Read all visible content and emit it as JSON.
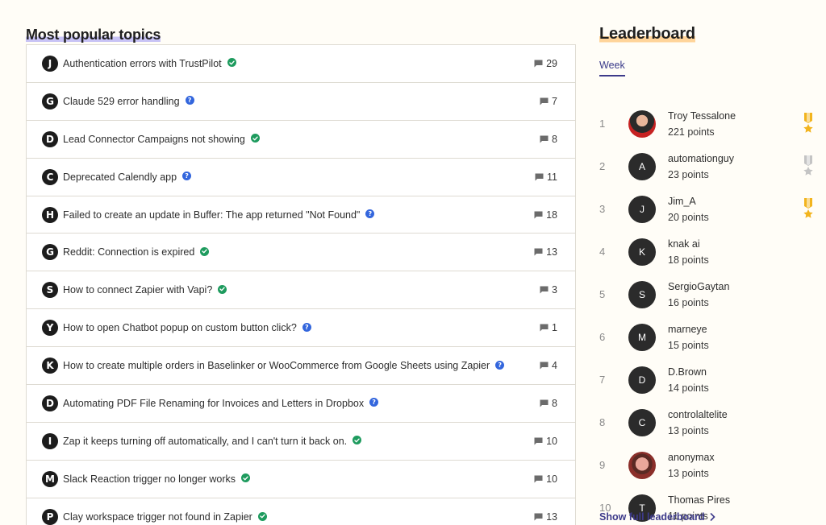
{
  "topics_section": {
    "title": "Most popular topics",
    "items": [
      {
        "letter": "J",
        "title": "Authentication errors with TrustPilot",
        "status": "solved",
        "replies": "29"
      },
      {
        "letter": "G",
        "title": "Claude 529 error handling",
        "status": "question",
        "replies": "7"
      },
      {
        "letter": "D",
        "title": "Lead Connector Campaigns not showing",
        "status": "solved",
        "replies": "8"
      },
      {
        "letter": "C",
        "title": "Deprecated Calendly app",
        "status": "question",
        "replies": "11"
      },
      {
        "letter": "H",
        "title": "Failed to create an update in Buffer: The app returned \"Not Found\"",
        "status": "question",
        "replies": "18"
      },
      {
        "letter": "G",
        "title": "Reddit: Connection is expired",
        "status": "solved",
        "replies": "13"
      },
      {
        "letter": "S",
        "title": "How to connect Zapier with Vapi?",
        "status": "solved",
        "replies": "3"
      },
      {
        "letter": "Y",
        "title": "How to open Chatbot popup on custom button click?",
        "status": "question",
        "replies": "1"
      },
      {
        "letter": "K",
        "title": "How to create multiple orders in Baselinker or WooCommerce from Google Sheets using Zapier",
        "status": "question",
        "replies": "4"
      },
      {
        "letter": "D",
        "title": "Automating PDF File Renaming for Invoices and Letters in Dropbox",
        "status": "question",
        "replies": "8"
      },
      {
        "letter": "I",
        "title": "Zap it keeps turning off automatically, and I can't turn it back on.",
        "status": "solved",
        "replies": "10"
      },
      {
        "letter": "M",
        "title": "Slack Reaction trigger no longer works",
        "status": "solved",
        "replies": "10"
      },
      {
        "letter": "P",
        "title": "Clay workspace trigger not found in Zapier",
        "status": "solved",
        "replies": "13"
      }
    ]
  },
  "leaderboard": {
    "title": "Leaderboard",
    "tab": "Week",
    "show_full_label": "Show full leaderboard",
    "entries": [
      {
        "rank": "1",
        "name": "Troy Tessalone",
        "points": "221 points",
        "avatar": "photo1",
        "initial": "",
        "medal": "gold"
      },
      {
        "rank": "2",
        "name": "automationguy",
        "points": "23 points",
        "avatar": "initial",
        "initial": "A",
        "medal": "silver"
      },
      {
        "rank": "3",
        "name": "Jim_A",
        "points": "20 points",
        "avatar": "initial",
        "initial": "J",
        "medal": "gold"
      },
      {
        "rank": "4",
        "name": "knak ai",
        "points": "18 points",
        "avatar": "initial",
        "initial": "K",
        "medal": ""
      },
      {
        "rank": "5",
        "name": "SergioGaytan",
        "points": "16 points",
        "avatar": "initial",
        "initial": "S",
        "medal": ""
      },
      {
        "rank": "6",
        "name": "marneye",
        "points": "15 points",
        "avatar": "initial",
        "initial": "M",
        "medal": ""
      },
      {
        "rank": "7",
        "name": "D.Brown",
        "points": "14 points",
        "avatar": "initial",
        "initial": "D",
        "medal": ""
      },
      {
        "rank": "8",
        "name": "controlaltelite",
        "points": "13 points",
        "avatar": "initial",
        "initial": "C",
        "medal": ""
      },
      {
        "rank": "9",
        "name": "anonymax",
        "points": "13 points",
        "avatar": "photo2",
        "initial": "",
        "medal": ""
      },
      {
        "rank": "10",
        "name": "Thomas Pires",
        "points": "11 points",
        "avatar": "initial",
        "initial": "T",
        "medal": ""
      }
    ]
  },
  "colors": {
    "solved": "#1e9b5e",
    "question": "#3366dd",
    "accent": "#3d3a8a",
    "medal_gold": "#f2b41e",
    "medal_silver": "#c4c4c4"
  }
}
